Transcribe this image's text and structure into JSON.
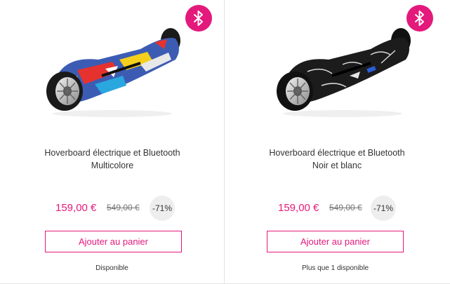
{
  "colors": {
    "accent": "#e4197c",
    "divider": "#e3e3e3",
    "discount_bg": "#eeeeee"
  },
  "products": [
    {
      "badge_icon": "bluetooth-icon",
      "image_icon": "hoverboard-multicolor-image",
      "title_line1": "Hoverboard électrique et Bluetooth",
      "title_line2": "Multicolore",
      "price": "159,00 €",
      "old_price": "549,00 €",
      "discount": "-71%",
      "add_to_cart_label": "Ajouter au panier",
      "availability": "Disponible"
    },
    {
      "badge_icon": "bluetooth-icon",
      "image_icon": "hoverboard-black-white-image",
      "title_line1": "Hoverboard électrique et Bluetooth",
      "title_line2": "Noir et blanc",
      "price": "159,00 €",
      "old_price": "549,00 €",
      "discount": "-71%",
      "add_to_cart_label": "Ajouter au panier",
      "availability": "Plus que 1 disponible"
    }
  ]
}
